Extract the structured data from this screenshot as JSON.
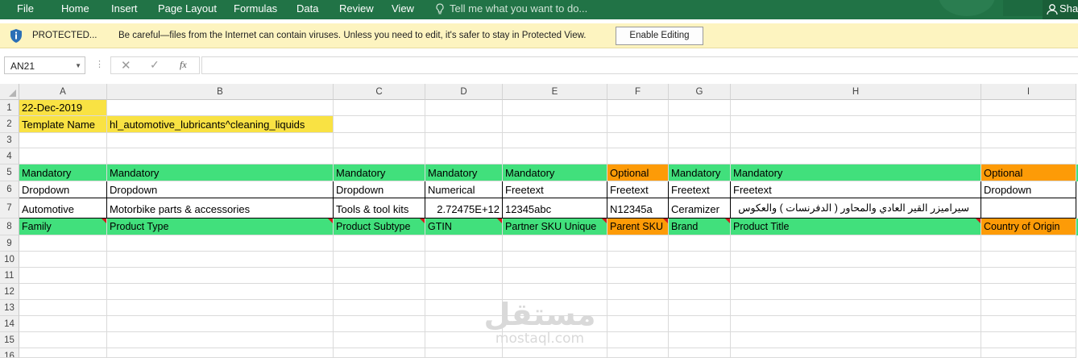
{
  "ribbon": {
    "tabs": [
      "File",
      "Home",
      "Insert",
      "Page Layout",
      "Formulas",
      "Data",
      "Review",
      "View"
    ],
    "tell_me": "Tell me what you want to do...",
    "share": "Sha",
    "bg_color": "#217346"
  },
  "protected_bar": {
    "title": "PROTECTED...",
    "message": "Be careful—files from the Internet can contain viruses. Unless you need to edit, it's safer to stay in Protected View.",
    "button": "Enable Editing",
    "bg_color": "#fdf4c0"
  },
  "formula_bar": {
    "name_box": "AN21",
    "fx_label": "fx",
    "formula": ""
  },
  "sheet": {
    "columns": [
      "A",
      "B",
      "C",
      "D",
      "E",
      "F",
      "G",
      "H",
      "I"
    ],
    "rows": [
      "1",
      "2",
      "3",
      "4",
      "5",
      "6",
      "7",
      "8",
      "9",
      "10",
      "11",
      "12",
      "13",
      "14",
      "15",
      "16"
    ],
    "r1": {
      "a": "22-Dec-2019"
    },
    "r2": {
      "a": "Template Name",
      "b": "hl_automotive_lubricants^cleaning_liquids"
    },
    "r5": [
      "Mandatory",
      "Mandatory",
      "Mandatory",
      "Mandatory",
      "Mandatory",
      "Optional",
      "Mandatory",
      "Mandatory",
      "Optional"
    ],
    "r6": [
      "Dropdown",
      "Dropdown",
      "Dropdown",
      "Numerical",
      "Freetext",
      "Freetext",
      "Freetext",
      "Freetext",
      "Dropdown"
    ],
    "r7": [
      "Automotive",
      "Motorbike parts & accessories",
      "Tools & tool kits",
      "2.72475E+12",
      "12345abc",
      "N12345a",
      "Ceramizer",
      "سيراميزر القير العادي والمحاور ( الدفرنسات ) والعكوس",
      ""
    ],
    "r8": [
      "Family",
      "Product Type",
      "Product Subtype",
      "GTIN",
      "Partner SKU Unique",
      "Parent SKU",
      "Brand",
      "Product Title",
      "Country of Origin"
    ],
    "colors": {
      "mandatory": "#41e07c",
      "optional": "#fd9b07",
      "highlight": "#f9e243",
      "comment": "#d2191a"
    }
  },
  "watermark": {
    "arabic": "مستقل",
    "latin": "mostaql.com"
  }
}
